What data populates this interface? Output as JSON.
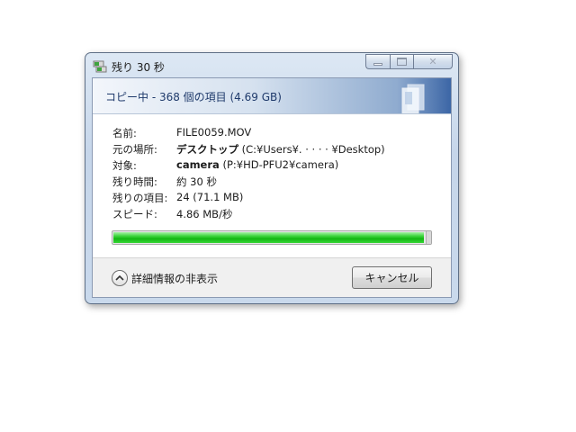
{
  "window": {
    "title": "残り 30 秒",
    "min_label": "",
    "max_label": "",
    "close_label": "✕"
  },
  "header": {
    "status": "コピー中 - 368 個の項目 (4.69 GB)"
  },
  "details": {
    "name": {
      "label": "名前:",
      "value": "FILE0059.MOV"
    },
    "source": {
      "label": "元の場所:",
      "value_bold": "デスクトップ",
      "value_rest": " (C:¥Users¥.  ·  ·  · ·  ¥Desktop)"
    },
    "target": {
      "label": "対象:",
      "value_bold": "camera",
      "value_rest": " (P:¥HD-PFU2¥camera)"
    },
    "time_left": {
      "label": "残り時間:",
      "value": "約 30 秒"
    },
    "items_left": {
      "label": "残りの項目:",
      "value": "24 (71.1 MB)"
    },
    "speed": {
      "label": "スピード:",
      "value": "4.86 MB/秒"
    }
  },
  "progress": {
    "percent": 98
  },
  "footer": {
    "toggle_label": "詳細情報の非表示",
    "cancel_label": "キャンセル"
  },
  "colors": {
    "progress_green": "#12b712",
    "header_text": "#1f3a6b"
  },
  "icons": {
    "title": "copy-file-icon",
    "toggle": "chevron-up-icon",
    "header": "document-pane-icon"
  }
}
